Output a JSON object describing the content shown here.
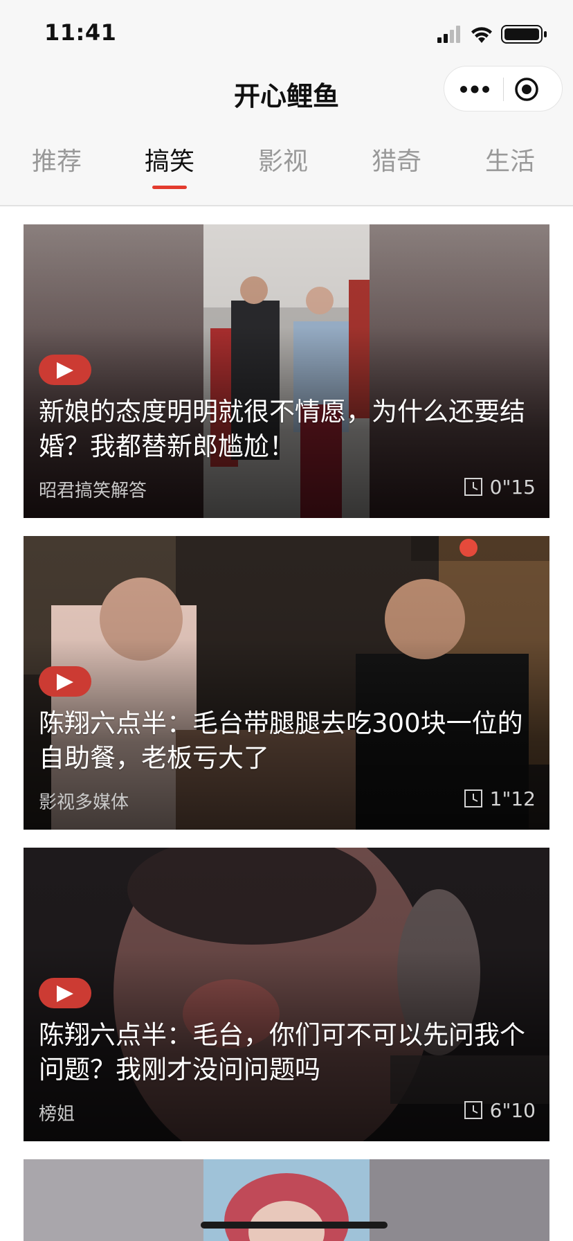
{
  "status_bar": {
    "time": "11:41"
  },
  "nav": {
    "title": "开心鲤鱼"
  },
  "tabs": [
    {
      "label": "推荐",
      "active": false
    },
    {
      "label": "搞笑",
      "active": true
    },
    {
      "label": "影视",
      "active": false
    },
    {
      "label": "猎奇",
      "active": false
    },
    {
      "label": "生活",
      "active": false
    }
  ],
  "videos": [
    {
      "title": "新娘的态度明明就很不情愿，为什么还要结婚？我都替新郎尴尬！",
      "author": "昭君搞笑解答",
      "duration": "0\"15"
    },
    {
      "title": "陈翔六点半：毛台带腿腿去吃300块一位的自助餐，老板亏大了",
      "author": "影视多媒体",
      "duration": "1\"12"
    },
    {
      "title": "陈翔六点半：毛台，你们可不可以先问我个问题？我刚才没问问题吗",
      "author": "榜姐",
      "duration": "6\"10"
    }
  ],
  "colors": {
    "accent": "#e33b2e",
    "play_badge": "#cc3b33"
  }
}
